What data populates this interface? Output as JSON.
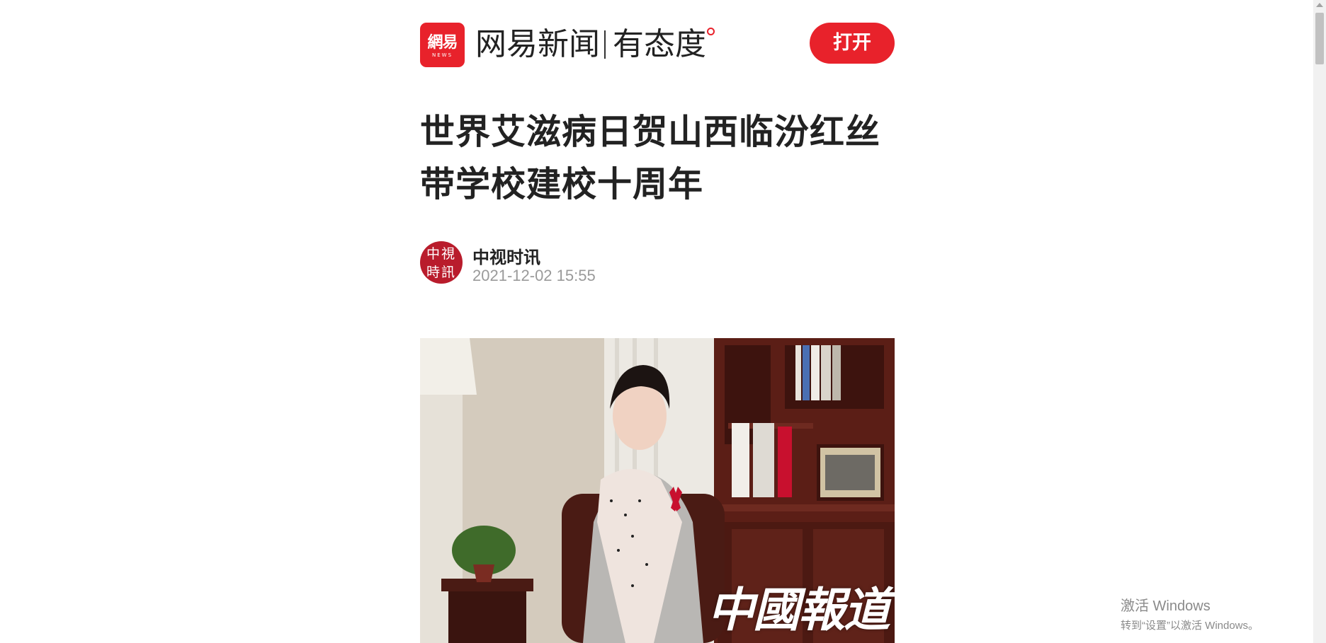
{
  "header": {
    "logo_cn": "網易",
    "logo_en": "NEWS",
    "brand_name": "网易新闻",
    "brand_slogan": "有态度",
    "open_button": "打开"
  },
  "article": {
    "title": "世界艾滋病日贺山西临汾红丝带学校建校十周年",
    "author": {
      "avatar_text": "中視時訊",
      "name": "中视时讯",
      "published": "2021-12-02 15:55"
    },
    "image": {
      "watermark": "中國報道"
    }
  },
  "system": {
    "activate_title": "激活 Windows",
    "activate_sub": "转到“设置”以激活 Windows。"
  },
  "colors": {
    "brand_red": "#e8222b",
    "avatar_red": "#b91c2c",
    "meta_gray": "#9a9a9a"
  }
}
